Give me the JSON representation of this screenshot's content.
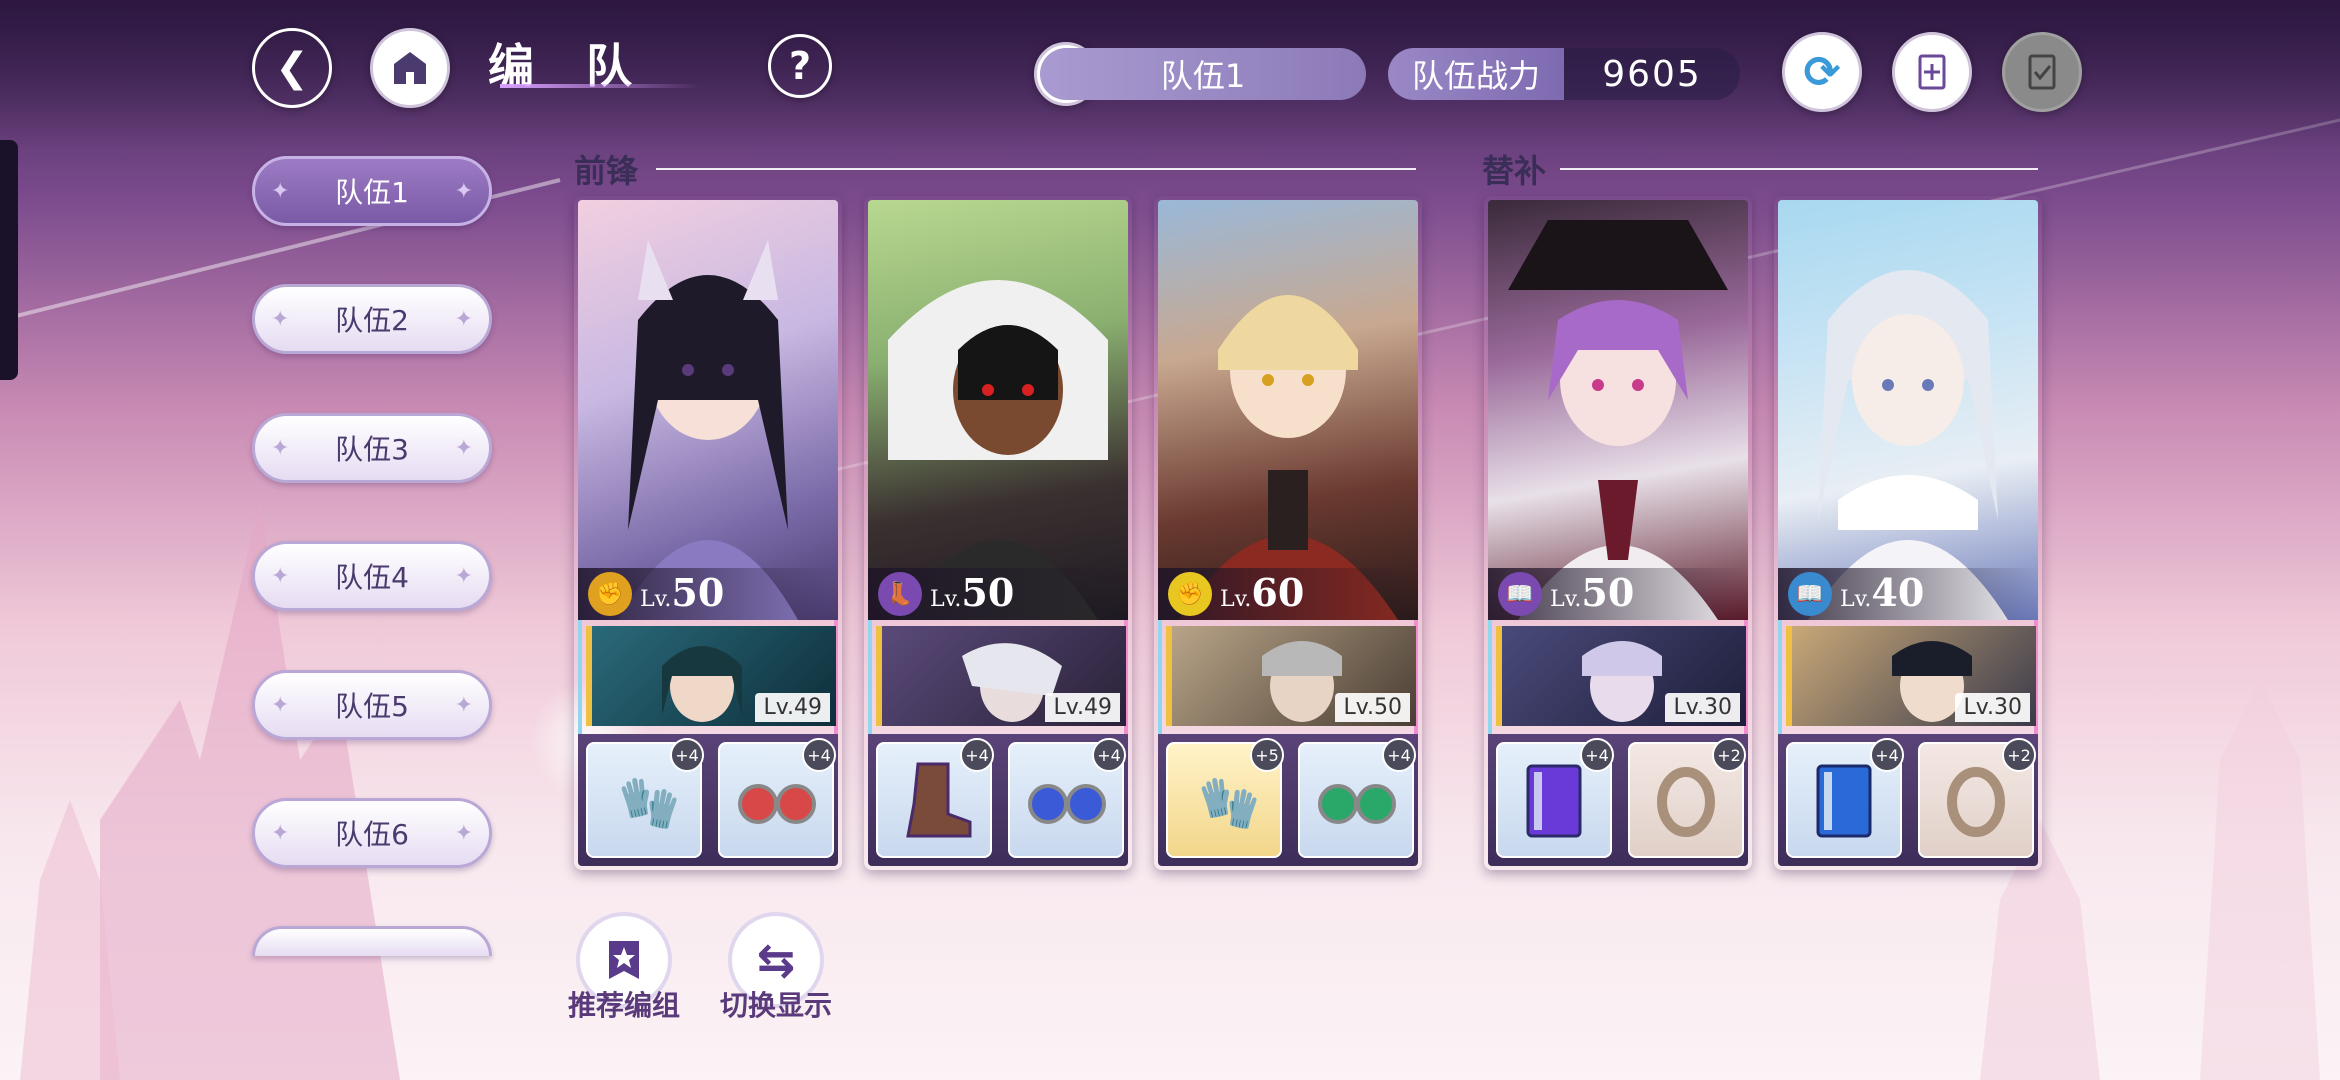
{
  "header": {
    "title": "编 队",
    "team_name": "队伍1",
    "power_label": "队伍战力",
    "power_value": "9605"
  },
  "sidebar": {
    "tabs": [
      {
        "label": "队伍1",
        "active": true
      },
      {
        "label": "队伍2",
        "active": false
      },
      {
        "label": "队伍3",
        "active": false
      },
      {
        "label": "队伍4",
        "active": false
      },
      {
        "label": "队伍5",
        "active": false
      },
      {
        "label": "队伍6",
        "active": false
      }
    ]
  },
  "sections": {
    "front": "前锋",
    "sub": "替补"
  },
  "cards": [
    {
      "level_prefix": "Lv.",
      "level": "50",
      "class_color": "#e0a020",
      "support_level": "Lv.49",
      "equip": [
        "+4",
        "+4"
      ]
    },
    {
      "level_prefix": "Lv.",
      "level": "50",
      "class_color": "#7a4ab0",
      "support_level": "Lv.49",
      "equip": [
        "+4",
        "+4"
      ]
    },
    {
      "level_prefix": "Lv.",
      "level": "60",
      "class_color": "#e8c820",
      "support_level": "Lv.50",
      "equip": [
        "+5",
        "+4"
      ]
    },
    {
      "level_prefix": "Lv.",
      "level": "50",
      "class_color": "#7a4ab0",
      "support_level": "Lv.30",
      "equip": [
        "+4",
        "+2"
      ]
    },
    {
      "level_prefix": "Lv.",
      "level": "40",
      "class_color": "#3a8ad0",
      "support_level": "Lv.30",
      "equip": [
        "+4",
        "+2"
      ]
    }
  ],
  "bottom": {
    "recommend_label": "推荐编组",
    "switch_label": "切换显示"
  },
  "icons": {
    "back": "back-arrow-icon",
    "home": "castle-icon",
    "help": "question-icon",
    "quill": "feather-icon",
    "refresh": "refresh-icon",
    "copy": "copy-add-icon",
    "confirm": "check-doc-icon"
  }
}
